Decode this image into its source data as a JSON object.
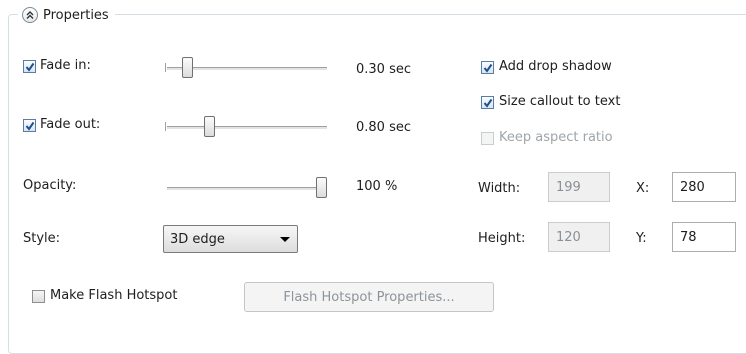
{
  "group": {
    "title": "Properties",
    "collapse_icon": "double-chevron-up-icon"
  },
  "fade_in": {
    "label": "Fade in:",
    "checked": true,
    "value_text": "0.30 sec",
    "slider_fraction": 0.1
  },
  "fade_out": {
    "label": "Fade out:",
    "checked": true,
    "value_text": "0.80 sec",
    "slider_fraction": 0.25
  },
  "opacity": {
    "label": "Opacity:",
    "value_text": "100 %",
    "slider_fraction": 1.0
  },
  "style": {
    "label": "Style:",
    "selected": "3D edge"
  },
  "options": {
    "add_drop_shadow": {
      "label": "Add drop shadow",
      "checked": true
    },
    "size_callout": {
      "label": "Size callout to text",
      "checked": true
    },
    "keep_aspect": {
      "label": "Keep aspect ratio",
      "checked": false,
      "disabled": true
    }
  },
  "size": {
    "width_label": "Width:",
    "width_value": "199",
    "height_label": "Height:",
    "height_value": "120",
    "x_label": "X:",
    "x_value": "280",
    "y_label": "Y:",
    "y_value": "78"
  },
  "flash": {
    "hotspot_label": "Make Flash Hotspot",
    "hotspot_checked": false,
    "properties_button": "Flash Hotspot Properties..."
  },
  "colors": {
    "check": "#1f4f8c",
    "border": "#d5dfe5",
    "disabled_text": "#9ea5ab"
  }
}
